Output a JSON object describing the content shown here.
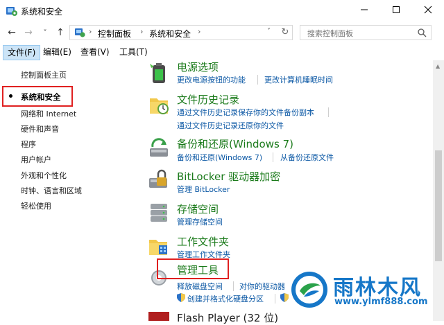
{
  "window": {
    "title": "系统和安全",
    "controls": {
      "minimize": "minimize-icon",
      "maximize": "maximize-icon",
      "close": "close-icon"
    }
  },
  "nav": {
    "back": "←",
    "forward": "→",
    "recent": "˅",
    "up": "↑"
  },
  "address": {
    "crumbs": [
      "控制面板",
      "系统和安全"
    ],
    "separator": "›",
    "refresh": "↻"
  },
  "search": {
    "placeholder": "搜索控制面板"
  },
  "menu": [
    "文件(F)",
    "编辑(E)",
    "查看(V)",
    "工具(T)"
  ],
  "sidebar": {
    "home": "控制面板主页",
    "items": [
      "系统和安全",
      "网络和 Internet",
      "硬件和声音",
      "程序",
      "用户帐户",
      "外观和个性化",
      "时钟、语言和区域",
      "轻松使用"
    ]
  },
  "sections": [
    {
      "title": "电源选项",
      "links": [
        "更改电源按钮的功能",
        "更改计算机睡眠时间"
      ],
      "icon": "power-options-icon"
    },
    {
      "title": "文件历史记录",
      "links": [
        "通过文件历史记录保存你的文件备份副本",
        "通过文件历史记录还原你的文件"
      ],
      "icon": "file-history-icon"
    },
    {
      "title": "备份和还原(Windows 7)",
      "links": [
        "备份和还原(Windows 7)",
        "从备份还原文件"
      ],
      "icon": "backup-restore-icon"
    },
    {
      "title": "BitLocker 驱动器加密",
      "links": [
        "管理 BitLocker"
      ],
      "icon": "bitlocker-icon"
    },
    {
      "title": "存储空间",
      "links": [
        "管理存储空间"
      ],
      "icon": "storage-spaces-icon"
    },
    {
      "title": "工作文件夹",
      "links": [
        "管理工作文件夹"
      ],
      "icon": "work-folders-icon"
    },
    {
      "title": "管理工具",
      "links": [
        "释放磁盘空间",
        "对你的驱动器",
        "创建并格式化硬盘分区"
      ],
      "icon": "admin-tools-icon"
    },
    {
      "title": "Flash Player (32 位)",
      "links": [],
      "icon": "flash-player-icon"
    }
  ],
  "watermark": {
    "title": "雨林木风",
    "url": "www.ylmf888.com"
  },
  "colors": {
    "section_title": "#1a7a1a",
    "link": "#0a57a4",
    "highlight_box": "#e02020",
    "watermark": "#1677c8",
    "menu_active_bg": "#cce4f7"
  }
}
